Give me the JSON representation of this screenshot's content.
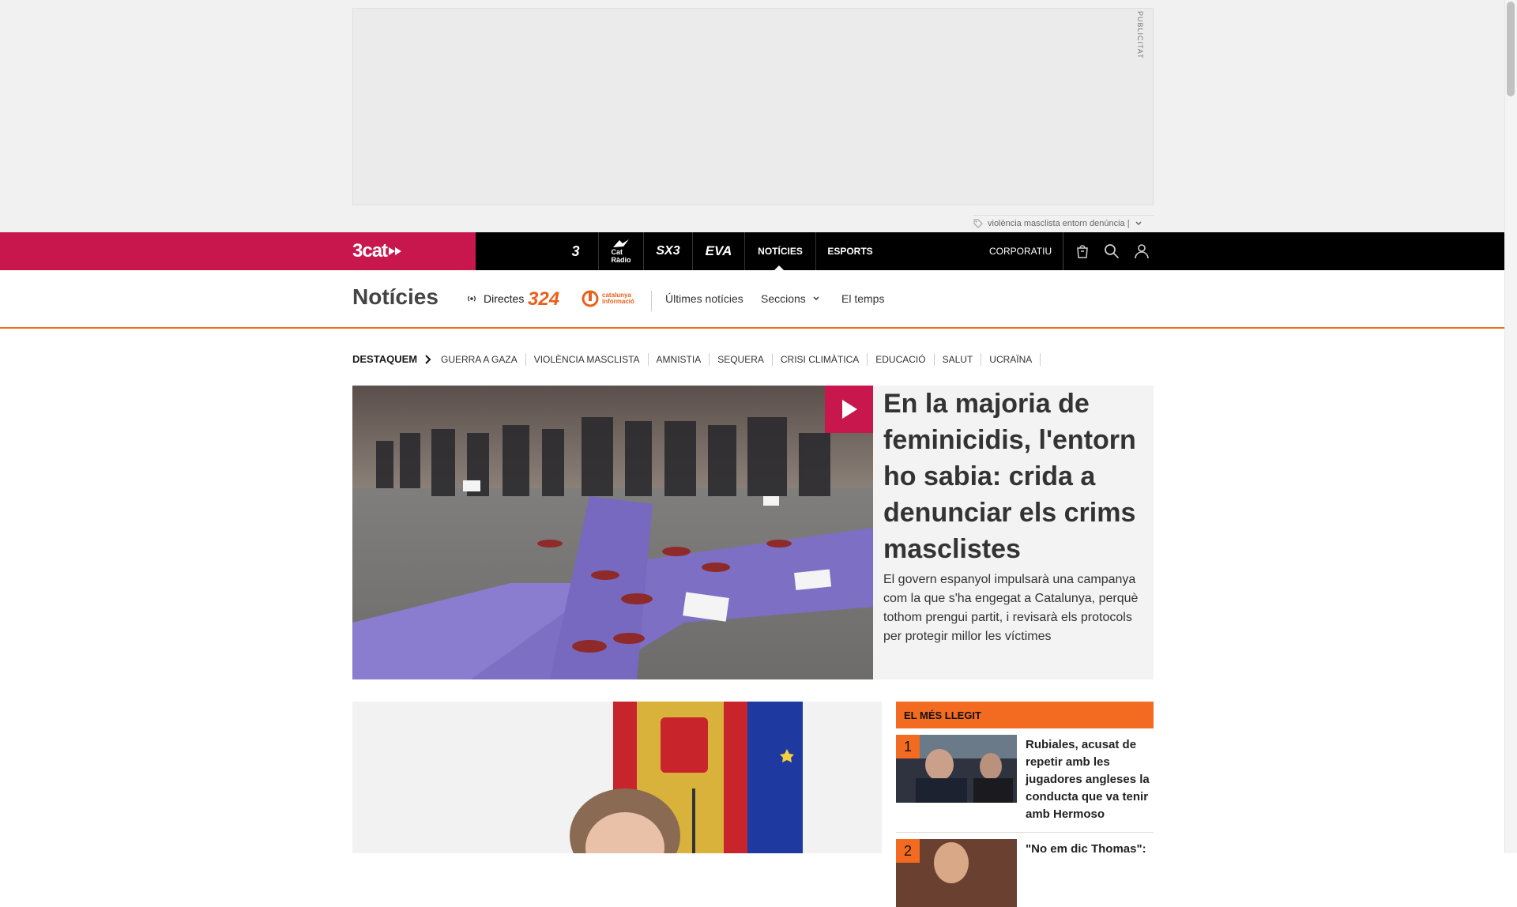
{
  "ad": {
    "label": "PUBLICITAT",
    "tag": "violència masclista entorn denúncia |"
  },
  "topbar": {
    "logo": "3cat",
    "channels": [
      "3",
      "Cat Ràdio",
      "SX3",
      "EVA",
      "NOTÍCIES",
      "ESPORTS"
    ],
    "active_channel": "NOTÍCIES",
    "corporatiu": "CORPORATIU"
  },
  "section": {
    "title": "Notícies",
    "directes": "Directes",
    "logo_324": "324",
    "logo_ci": "catalunya informació",
    "nav": [
      "Últimes notícies",
      "Seccions",
      "El temps"
    ]
  },
  "destaquem": {
    "label": "DESTAQUEM",
    "topics": [
      "GUERRA A GAZA",
      "VIOLÈNCIA MASCLISTA",
      "AMNISTIA",
      "SEQUERA",
      "CRISI CLIMÀTICA",
      "EDUCACIÓ",
      "SALUT",
      "UCRAÏNA"
    ]
  },
  "hero": {
    "title": "En la majoria de feminicidis, l'entorn ho sabia: crida a denunciar els crims masclistes",
    "summary": "El govern espanyol impulsarà una campanya com la que s'ha engegat a Catalunya, perquè tothom prengui partit, i revisarà els protocols per protegir millor les víctimes"
  },
  "mes_llegit": {
    "heading": "EL MÉS LLEGIT",
    "items": [
      {
        "num": "1",
        "title": "Rubiales, acusat de repetir amb les jugadores angleses la conducta que va tenir amb Hermoso"
      },
      {
        "num": "2",
        "title": "\"No em dic Thomas\":"
      }
    ]
  },
  "colors": {
    "brand": "#c8174d",
    "accent": "#f26b21",
    "topbar": "#000000"
  }
}
